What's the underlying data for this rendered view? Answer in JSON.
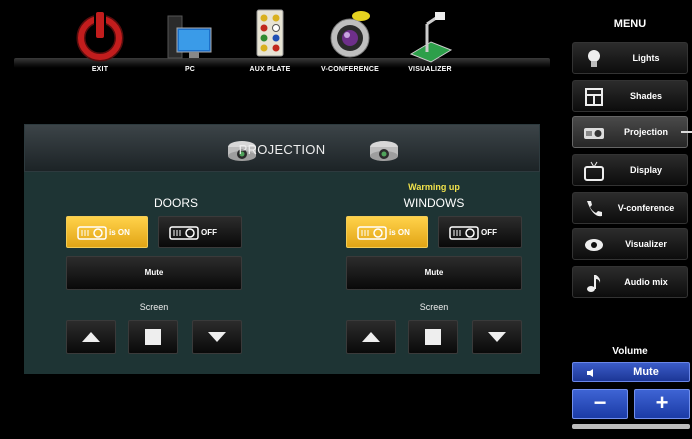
{
  "sources": [
    {
      "label": "EXIT",
      "icon": "power-icon"
    },
    {
      "label": "PC",
      "icon": "pc-icon"
    },
    {
      "label": "AUX PLATE",
      "icon": "aux-plate-icon"
    },
    {
      "label": "V-CONFERENCE",
      "icon": "camera-icon"
    },
    {
      "label": "VISUALIZER",
      "icon": "document-camera-icon"
    }
  ],
  "menu": {
    "title": "MENU",
    "items": [
      {
        "label": "Lights",
        "icon": "bulb-icon"
      },
      {
        "label": "Shades",
        "icon": "window-icon"
      },
      {
        "label": "Projection",
        "icon": "projector-icon",
        "active": true
      },
      {
        "label": "Display",
        "icon": "tv-icon"
      },
      {
        "label": "V-conference",
        "icon": "phone-icon"
      },
      {
        "label": "Visualizer",
        "icon": "eye-icon"
      },
      {
        "label": "Audio mix",
        "icon": "note-icon"
      }
    ]
  },
  "volume": {
    "title": "Volume",
    "mute": "Mute",
    "minus": "−",
    "plus": "+"
  },
  "panel": {
    "title": "PROJECTION",
    "zones": [
      {
        "name": "DOORS",
        "status": "",
        "on_label": "is ON",
        "off_label": "OFF",
        "mute": "Mute",
        "screen": "Screen"
      },
      {
        "name": "WINDOWS",
        "status": "Warming up",
        "on_label": "is ON",
        "off_label": "OFF",
        "mute": "Mute",
        "screen": "Screen"
      }
    ]
  },
  "colors": {
    "accent_on": "#f2b92a",
    "volume_blue": "#2a4bb8",
    "panel_bg": "#1e3434",
    "warning": "#f1e24b"
  }
}
